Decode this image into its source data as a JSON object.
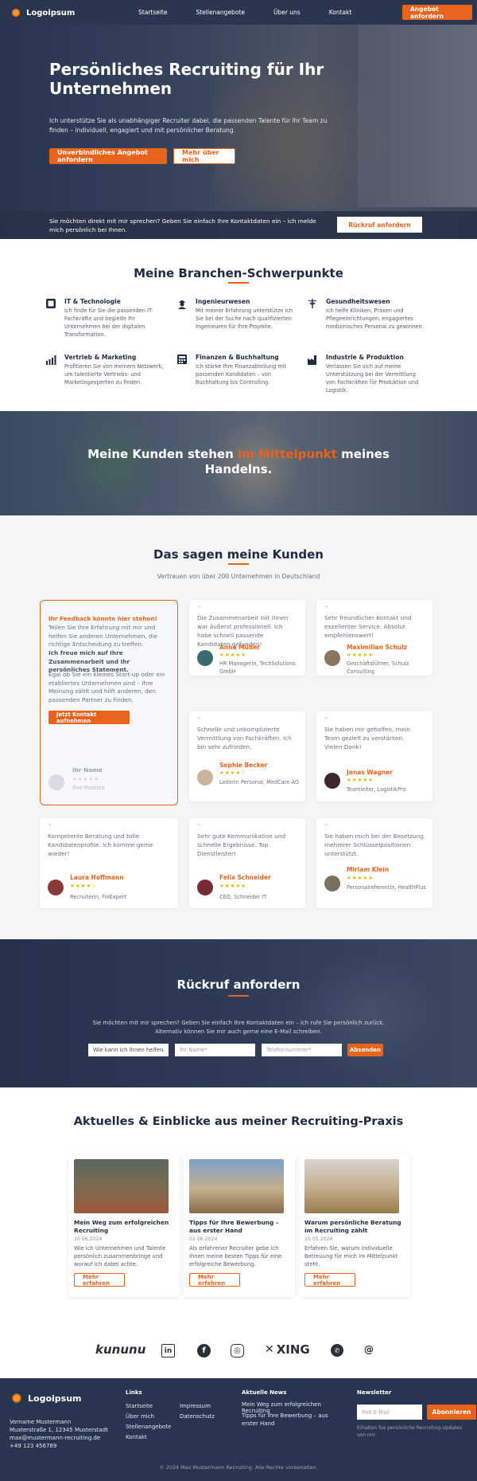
{
  "header": {
    "logo_text": "Logoipsum",
    "nav": [
      "Startseite",
      "Stellenangebote",
      "Über uns",
      "Kontakt"
    ],
    "cta": "Angebot anfordern"
  },
  "hero": {
    "title": "Persönliches Recruiting für Ihr Unternehmen",
    "text": "Ich unterstütze Sie als unabhängiger Recruiter dabei, die passenden Talente für Ihr Team zu finden – individuell, engagiert und mit persönlicher Beratung.",
    "btn_primary": "Unverbindliches Angebot anfordern",
    "btn_secondary": "Mehr über mich",
    "callbar_text": "Sie möchten direkt mit mir sprechen? Geben Sie einfach Ihre Kontaktdaten ein – ich melde mich persönlich bei Ihnen.",
    "callbar_button": "Rückruf anfordern"
  },
  "branches": {
    "title": "Meine Branchen-Schwerpunkte",
    "items": [
      {
        "icon": "monitor-icon",
        "title": "IT & Technologie",
        "text": "Ich finde für Sie die passenden IT-Fachkräfte und begleite Ihr Unternehmen bei der digitalen Transformation."
      },
      {
        "icon": "engineer-icon",
        "title": "Ingenieurwesen",
        "text": "Mit meiner Erfahrung unterstütze ich Sie bei der Suche nach qualifizierten Ingenieuren für Ihre Projekte."
      },
      {
        "icon": "caduceus-icon",
        "title": "Gesundheitswesen",
        "text": "Ich helfe Kliniken, Praxen und Pflegeeinrichtungen, engagiertes medizinisches Personal zu gewinnen."
      },
      {
        "icon": "chart-growth-icon",
        "title": "Vertrieb & Marketing",
        "text": "Profitieren Sie von meinem Netzwerk, um talentierte Vertriebs- und Marketingexperten zu finden."
      },
      {
        "icon": "calculator-icon",
        "title": "Finanzen & Buchhaltung",
        "text": "Ich stärke Ihre Finanzabteilung mit passenden Kandidaten – von Buchhaltung bis Controlling."
      },
      {
        "icon": "factory-icon",
        "title": "Industrie & Produktion",
        "text": "Verlassen Sie sich auf meine Unterstützung bei der Vermittlung von Fachkräften für Produktion und Logistik."
      }
    ]
  },
  "banner": {
    "before": "Meine Kunden stehen ",
    "highlight": "im Mittelpunkt",
    "after": " meines Handelns."
  },
  "testimonials": {
    "title": "Das sagen meine Kunden",
    "subtitle": "Vertrauen von über 200 Unternehmen in Deutschland",
    "feedback": {
      "line1": "Ihr Feedback könnte hier stehen!",
      "line2": "Teilen Sie Ihre Erfahrung mit mir und helfen Sie anderen Unternehmen, die richtige Entscheidung zu treffen.",
      "line3": "Ich freue mich auf Ihre Zusammenarbeit und Ihr persönliches Statement.",
      "line4": "Egal ob Sie ein kleines Start-up oder ein etabliertes Unternehmen sind – Ihre Meinung zählt und hilft anderen, den passenden Partner zu finden.",
      "button": "Jetzt Kontakt aufnehmen",
      "name": "Ihr Name",
      "stars": "★★★★★",
      "position": "Ihre Position"
    },
    "items": [
      {
        "text": "Die Zusammenarbeit mit Ihnen war äußerst professionell. Ich habe schnell passende Kandidaten gefunden!",
        "name": "Anna Müller",
        "stars": "★★★★★",
        "role": "HR Managerin, TechSolutions GmbH"
      },
      {
        "text": "Sehr freundlicher Kontakt und exzellenter Service. Absolut empfehlenswert!",
        "name": "Maximilian Schulz",
        "stars": "★★★★★",
        "role": "Geschäftsführer, Schulz Consulting"
      },
      {
        "text": "Schnelle und unkomplizierte Vermittlung von Fachkräften. Ich bin sehr zufrieden.",
        "name": "Sophie Becker",
        "stars": "★★★★☆",
        "role": "Leiterin Personal, MedCare AG"
      },
      {
        "text": "Sie haben mir geholfen, mein Team gezielt zu verstärken. Vielen Dank!",
        "name": "Jonas Wagner",
        "stars": "★★★★★",
        "role": "Teamleiter, LogistikPro"
      },
      {
        "text": "Kompetente Beratung und tolle Kandidatenprofile. Ich komme gerne wieder!",
        "name": "Laura Hoffmann",
        "stars": "★★★★☆",
        "role": "Recruiterin, FinExpert"
      },
      {
        "text": "Sehr gute Kommunikation und schnelle Ergebnisse. Top Dienstleister!",
        "name": "Felix Schneider",
        "stars": "★★★★★",
        "role": "CEO, Schneider IT"
      },
      {
        "text": "Sie haben mich bei der Besetzung mehrerer Schlüsselpositionen unterstützt.",
        "name": "Miriam Klein",
        "stars": "★★★★★",
        "role": "Personalreferentin, HealthPlus"
      }
    ]
  },
  "callback": {
    "title": "Rückruf anfordern",
    "text": "Sie möchten mit mir sprechen? Geben Sie einfach Ihre Kontaktdaten ein – ich rufe Sie persönlich zurück. Alternativ können Sie mir auch gerne eine E-Mail schreiben.",
    "select_value": "Wie kann ich Ihnen helfen",
    "name_placeholder": "Ihr Name*",
    "phone_placeholder": "Telefonnummer*",
    "submit": "Absenden"
  },
  "news": {
    "title": "Aktuelles & Einblicke aus meiner Recruiting-Praxis",
    "items": [
      {
        "title": "Mein Weg zum erfolgreichen Recruiting",
        "date": "10.06.2024",
        "text": "Wie ich Unternehmen und Talente persönlich zusammenbringe und worauf ich dabei achte.",
        "button": "Mehr erfahren"
      },
      {
        "title": "Tipps für Ihre Bewerbung – aus erster Hand",
        "date": "02.06.2024",
        "text": "Als erfahrener Recruiter gebe ich Ihnen meine besten Tipps für eine erfolgreiche Bewerbung.",
        "button": "Mehr erfahren"
      },
      {
        "title": "Warum persönliche Beratung im Recruiting zählt",
        "date": "25.05.2024",
        "text": "Erfahren Sie, warum individuelle Betreuung für mich im Mittelpunkt steht.",
        "button": "Mehr erfahren"
      }
    ]
  },
  "partners": [
    "kununu",
    "in",
    "f",
    "◎",
    "XING",
    "✆",
    "@"
  ],
  "footer": {
    "logo_text": "Logoipsum",
    "address": [
      "Vorname Mustermann",
      "Musterstraße 1, 12345 Musterstadt",
      "max@mustermann-recruiting.de",
      "+49 123 456789"
    ],
    "links_title": "Links",
    "links_col1": [
      "Startseite",
      "Über mich",
      "Stellenangebote",
      "Kontakt"
    ],
    "links_col2": [
      "Impressum",
      "Datenschutz"
    ],
    "news_title": "Aktuelle News",
    "news_links": [
      "Mein Weg zum erfolgreichen Recruiting",
      "Tipps für Ihre Bewerbung – aus erster Hand"
    ],
    "newsletter_title": "Newsletter",
    "newsletter_placeholder": "Ihre E-Mail",
    "newsletter_button": "Abonnieren",
    "newsletter_note": "Erhalten Sie persönliche Recruiting-Updates von mir.",
    "copyright": "© 2024 Max Mustermann Recruiting. Alle Rechte vorbehalten."
  }
}
